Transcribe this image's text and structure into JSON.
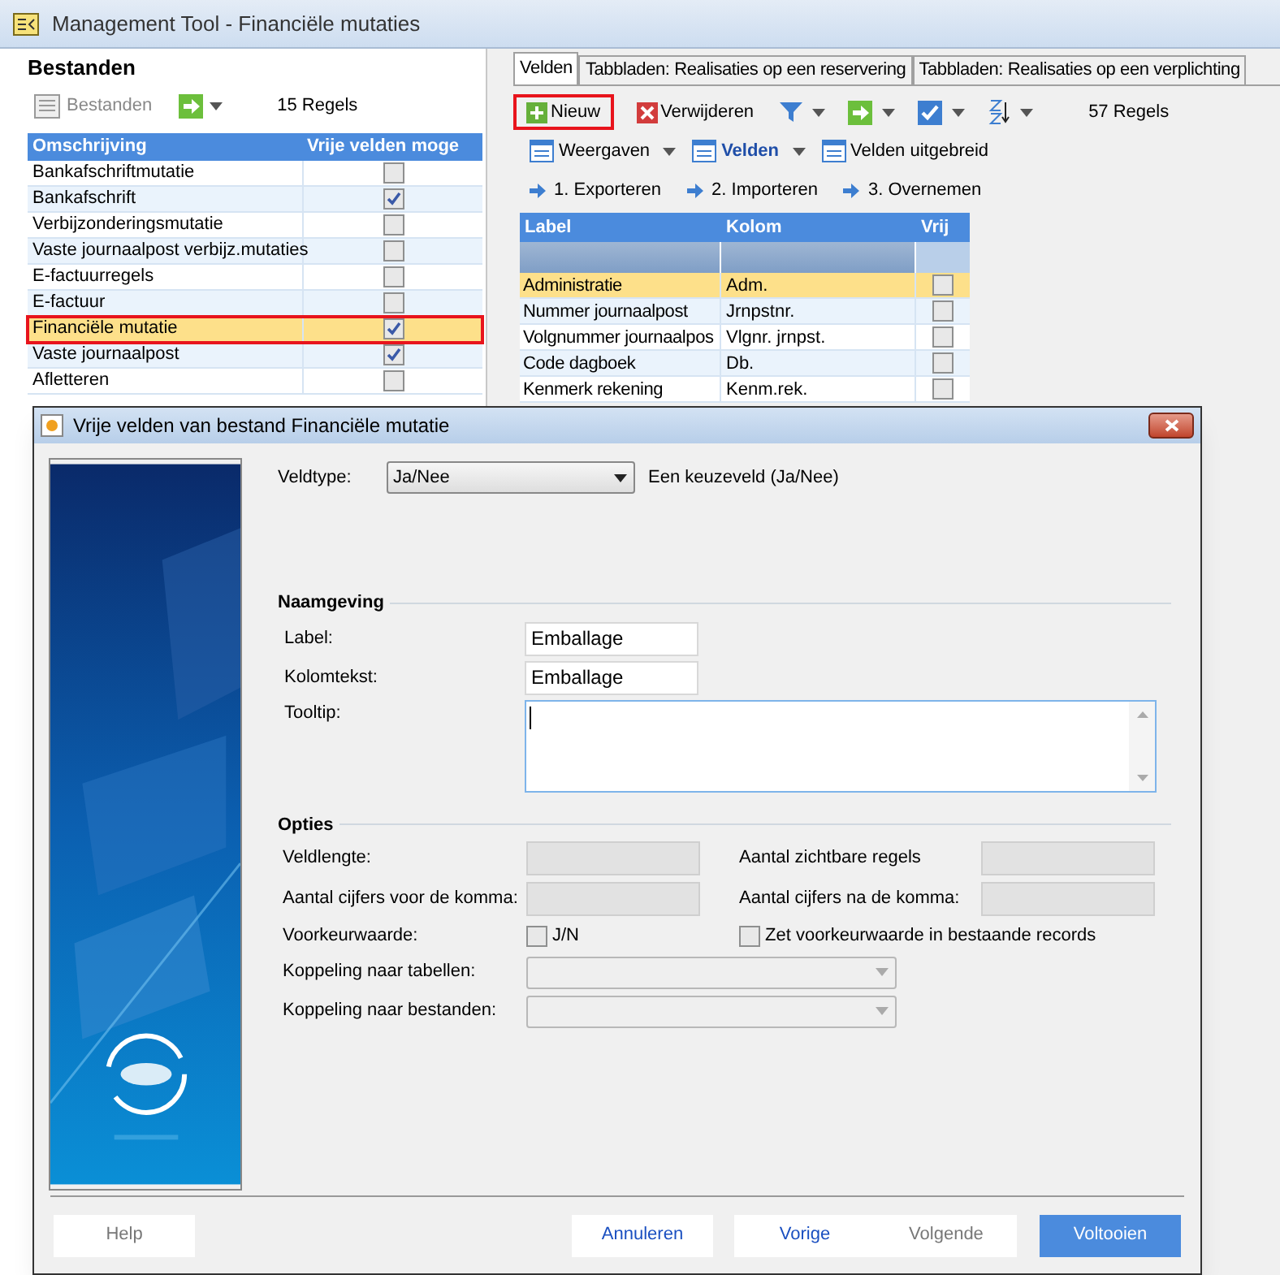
{
  "window": {
    "title": "Management Tool - Financiële mutaties"
  },
  "left_panel": {
    "title": "Bestanden",
    "toolbar": {
      "button": {
        "label": "Bestanden",
        "disabled": true
      },
      "count": "15 Regels"
    },
    "columns": [
      "Omschrijving",
      "Vrije velden moge"
    ],
    "rows": [
      {
        "label": "Bankafschriftmutatie",
        "checked": false,
        "selected": false,
        "outlined": false
      },
      {
        "label": "Bankafschrift",
        "checked": true,
        "selected": false,
        "outlined": false
      },
      {
        "label": "Verbijzonderingsmutatie",
        "checked": false,
        "selected": false,
        "outlined": false
      },
      {
        "label": "Vaste journaalpost verbijz.mutaties",
        "checked": false,
        "selected": false,
        "outlined": false
      },
      {
        "label": "E-factuurregels",
        "checked": false,
        "selected": false,
        "outlined": false
      },
      {
        "label": "E-factuur",
        "checked": false,
        "selected": false,
        "outlined": false
      },
      {
        "label": "Financiële mutatie",
        "checked": true,
        "selected": true,
        "outlined": true
      },
      {
        "label": "Vaste journaalpost",
        "checked": true,
        "selected": false,
        "outlined": false
      },
      {
        "label": "Afletteren",
        "checked": false,
        "selected": false,
        "outlined": false
      }
    ]
  },
  "right_panel": {
    "tabs": [
      {
        "label": "Velden",
        "selected": true
      },
      {
        "label": "Tabbladen: Realisaties op een reservering",
        "selected": false
      },
      {
        "label": "Tabbladen: Realisaties op een verplichting",
        "selected": false
      }
    ],
    "toolbar": {
      "buttons": [
        {
          "kind": "add",
          "label": "Nieuw",
          "outlined": true
        },
        {
          "kind": "delete",
          "label": "Verwijderen",
          "outlined": false
        }
      ],
      "count": "57 Regels"
    },
    "views": [
      {
        "label": "Weergaven",
        "selected": false,
        "dropdown": true
      },
      {
        "label": "Velden",
        "selected": true,
        "dropdown": true
      },
      {
        "label": "Velden uitgebreid",
        "selected": false,
        "dropdown": false
      }
    ],
    "actions": [
      "1. Exporteren",
      "2. Importeren",
      "3. Overnemen"
    ],
    "columns": [
      "Label",
      "Kolom",
      "Vrij"
    ],
    "rows": [
      {
        "label": "Administratie",
        "kolom": "Adm.",
        "vrij": false,
        "selected": true
      },
      {
        "label": "Nummer journaalpost",
        "kolom": "Jrnpstnr.",
        "vrij": false,
        "selected": false
      },
      {
        "label": "Volgnummer journaalpos",
        "kolom": "Vlgnr. jrnpst.",
        "vrij": false,
        "selected": false
      },
      {
        "label": "Code dagboek",
        "kolom": "Db.",
        "vrij": false,
        "selected": false
      },
      {
        "label": "Kenmerk rekening",
        "kolom": "Kenm.rek.",
        "vrij": false,
        "selected": false
      }
    ]
  },
  "dialog": {
    "title": "Vrije velden van bestand Financiële mutatie",
    "veldtype": {
      "label": "Veldtype:",
      "value": "Ja/Nee",
      "description": "Een keuzeveld (Ja/Nee)"
    },
    "naamgeving": {
      "title": "Naamgeving",
      "fields": [
        {
          "label": "Label:",
          "value": "Emballage"
        },
        {
          "label": "Kolomtekst:",
          "value": "Emballage"
        }
      ],
      "tooltip": {
        "label": "Tooltip:"
      }
    },
    "opties": {
      "title": "Opties",
      "items": [
        {
          "kind": "text",
          "label": "Veldlengte:"
        },
        {
          "kind": "text",
          "label": "Aantal zichtbare regels"
        },
        {
          "kind": "text",
          "label": "Aantal cijfers voor de komma:"
        },
        {
          "kind": "text",
          "label": "Aantal cijfers na de komma:"
        },
        {
          "kind": "checkbox",
          "label": "Voorkeurwaarde:",
          "caption": "J/N",
          "checked": false
        },
        {
          "kind": "checkbox",
          "caption": "Zet voorkeurwaarde in bestaande records",
          "checked": false
        },
        {
          "kind": "select",
          "label": "Koppeling naar tabellen:"
        },
        {
          "kind": "select",
          "label": "Koppeling naar bestanden:"
        }
      ]
    },
    "buttons": [
      {
        "label": "Help",
        "kind": "normal",
        "disabled": true
      },
      {
        "label": "Annuleren",
        "kind": "normal",
        "disabled": false
      },
      {
        "label": "Vorige",
        "kind": "normal",
        "disabled": false
      },
      {
        "label": "Volgende",
        "kind": "normal",
        "disabled": true
      },
      {
        "label": "Voltooien",
        "kind": "primary",
        "disabled": false
      }
    ]
  }
}
